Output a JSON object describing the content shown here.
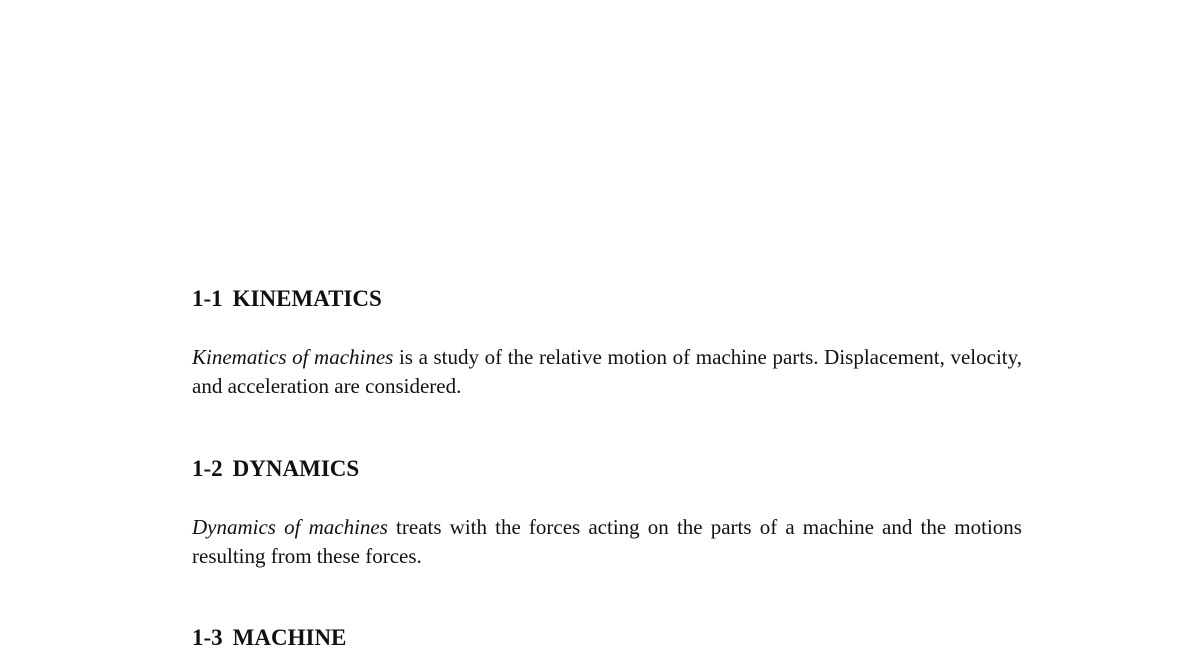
{
  "sections": [
    {
      "number": "1-1",
      "title": "KINEMATICS",
      "term": "Kinematics of machines",
      "body": " is a study of the relative motion of machine parts. Displacement, velocity, and acceleration are considered."
    },
    {
      "number": "1-2",
      "title": "DYNAMICS",
      "term": "Dynamics of machines",
      "body": " treats with the forces acting on the parts of a machine and the motions resulting from these forces."
    },
    {
      "number": "1-3",
      "title": "MACHINE"
    }
  ]
}
